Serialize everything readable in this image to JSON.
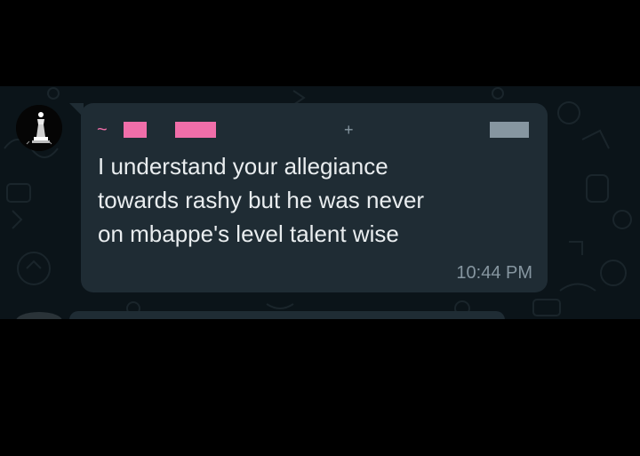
{
  "chat": {
    "message": {
      "sender_prefix": "~",
      "phone_prefix": "+",
      "lines": [
        "I understand your allegiance",
        "towards rashy but he was never",
        "on mbappe's level talent wise"
      ],
      "time": "10:44 PM"
    }
  },
  "colors": {
    "screen_background": "#000000",
    "chat_background": "#0b1419",
    "bubble": "#1f2c34",
    "message_text": "#e9edef",
    "meta_text": "#8696a0",
    "sender_name": "#f06ea9"
  },
  "icons": {
    "avatar": "chess-piece-avatar-icon"
  }
}
